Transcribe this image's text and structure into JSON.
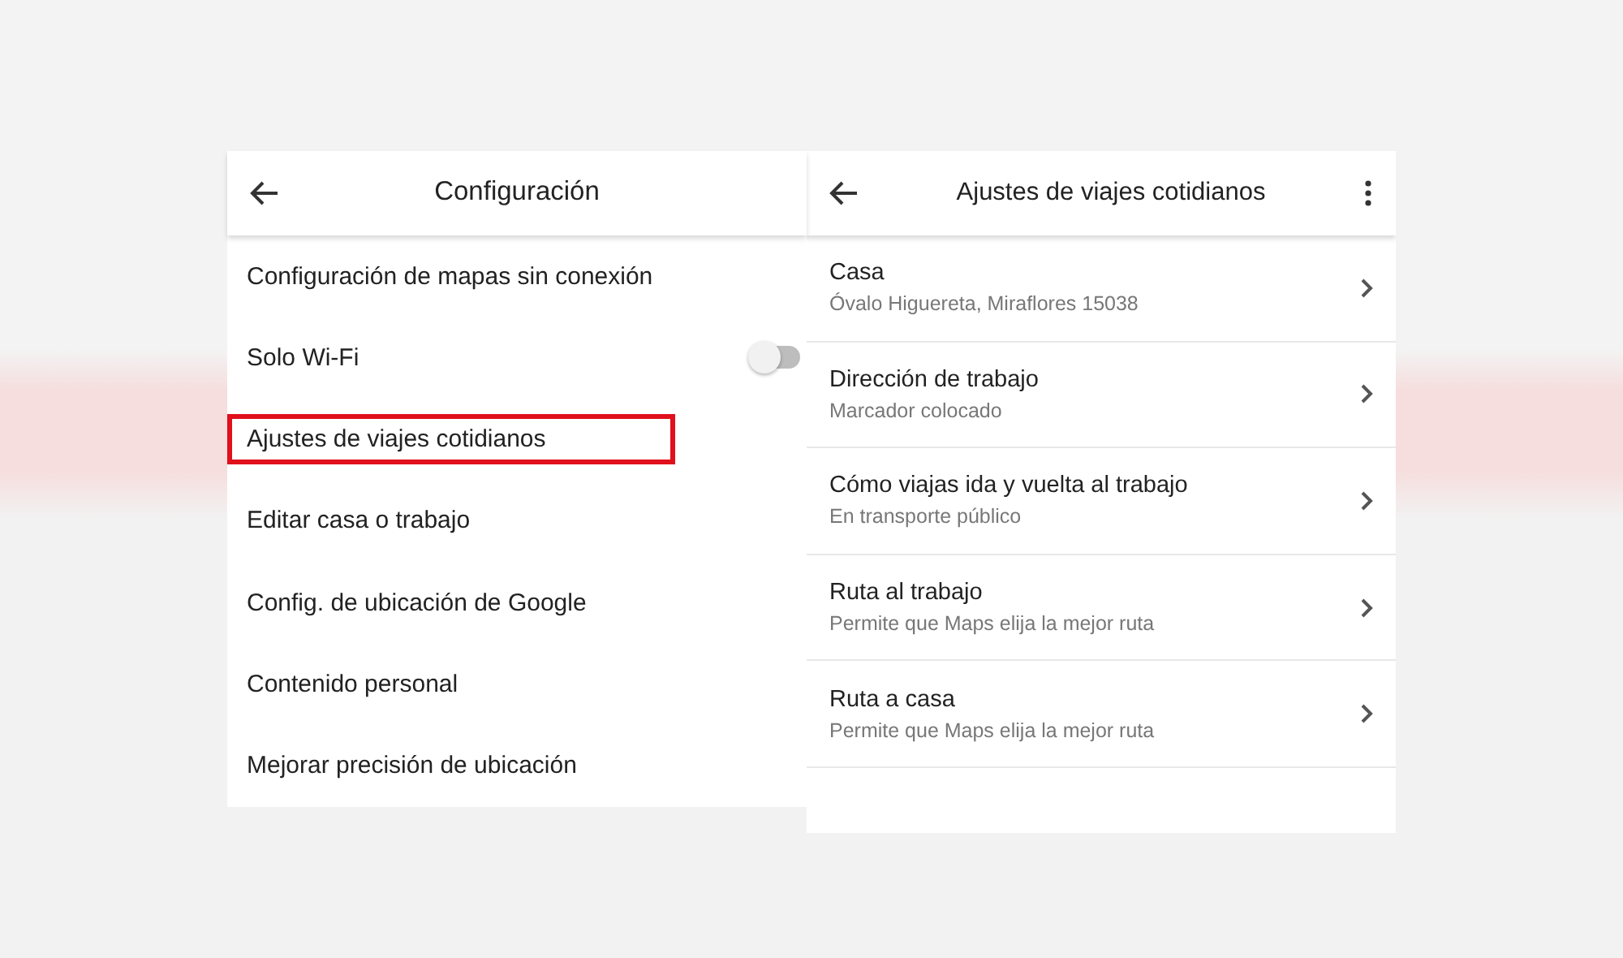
{
  "left_screen": {
    "title": "Configuración",
    "items": [
      {
        "label": "Configuración de mapas sin conexión",
        "kind": "link",
        "highlighted": false
      },
      {
        "label": "Solo Wi-Fi",
        "kind": "toggle",
        "on": false,
        "highlighted": false
      },
      {
        "label": "Ajustes de viajes cotidianos",
        "kind": "link",
        "highlighted": true
      },
      {
        "label": "Editar casa o trabajo",
        "kind": "link",
        "highlighted": false
      },
      {
        "label": "Config. de ubicación de Google",
        "kind": "link",
        "highlighted": false
      },
      {
        "label": "Contenido personal",
        "kind": "link",
        "highlighted": false
      },
      {
        "label": "Mejorar precisión de ubicación",
        "kind": "link",
        "highlighted": false
      }
    ]
  },
  "right_screen": {
    "title": "Ajustes de viajes cotidianos",
    "items": [
      {
        "label": "Casa",
        "detail": "Óvalo Higuereta, Miraflores 15038"
      },
      {
        "label": "Dirección de trabajo",
        "detail": "Marcador colocado"
      },
      {
        "label": "Cómo viajas ida y vuelta al trabajo",
        "detail": "En transporte público"
      },
      {
        "label": "Ruta al trabajo",
        "detail": "Permite que Maps elija la mejor ruta"
      },
      {
        "label": "Ruta a casa",
        "detail": "Permite que Maps elija la mejor ruta"
      }
    ]
  }
}
